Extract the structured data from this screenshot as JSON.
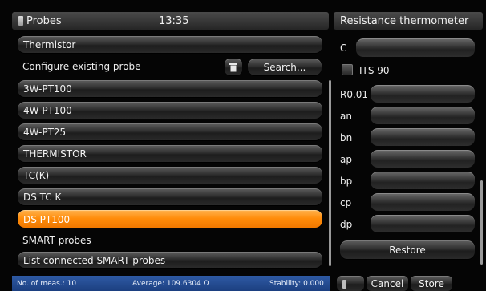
{
  "header": {
    "title": "Probes",
    "time": "13:35"
  },
  "right_header": {
    "title": "Resistance thermometer"
  },
  "probe_type": {
    "label": "Thermistor"
  },
  "configure": {
    "label": "Configure existing probe",
    "search_label": "Search..."
  },
  "probes": [
    {
      "label": "3W-PT100",
      "selected": false
    },
    {
      "label": "4W-PT100",
      "selected": false
    },
    {
      "label": "4W-PT25",
      "selected": false
    },
    {
      "label": "THERMISTOR",
      "selected": false
    },
    {
      "label": "TC(K)",
      "selected": false
    },
    {
      "label": "DS TC K",
      "selected": false
    },
    {
      "label": "DS PT100",
      "selected": true
    }
  ],
  "smart": {
    "heading": "SMART probes",
    "list_label": "List connected SMART probes"
  },
  "coefficients": {
    "c_label": "C",
    "its90_label": "ITS 90",
    "its90_checked": false,
    "rows": [
      "R0.01",
      "an",
      "bn",
      "ap",
      "bp",
      "cp",
      "dp"
    ]
  },
  "buttons": {
    "restore": "Restore",
    "cancel": "Cancel",
    "store": "Store"
  },
  "status": {
    "measurements": "No. of meas.: 10",
    "average": "Average: 109.6304 Ω",
    "stability": "Stability: 0.000"
  },
  "colors": {
    "selected": "#ff8c0a",
    "status_bar": "#234a92",
    "background": "#050505"
  }
}
